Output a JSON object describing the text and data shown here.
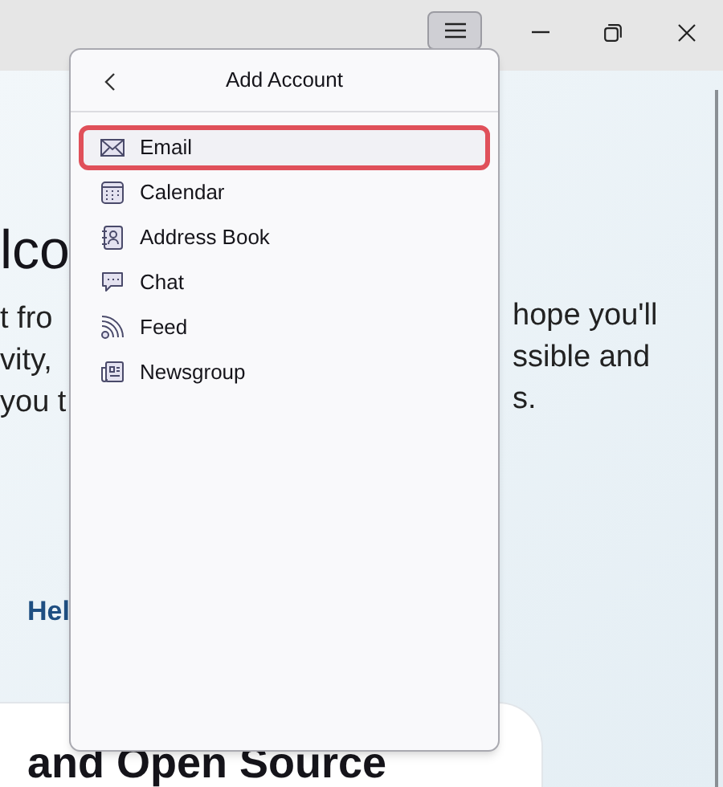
{
  "title_bar": {
    "menu_button": {
      "selected": true
    }
  },
  "background": {
    "left_fragments": [
      {
        "kind": "heading",
        "text": "lco"
      },
      {
        "kind": "line",
        "text": "t fro"
      },
      {
        "kind": "line",
        "text": "vity,"
      },
      {
        "kind": "line",
        "text": "you t"
      },
      {
        "kind": "link",
        "text": "Hel"
      }
    ],
    "right_fragments": [
      "hope you'll",
      "ssible and",
      "s."
    ],
    "card_heading": "and Open Source"
  },
  "menu": {
    "title": "Add Account",
    "items": [
      {
        "kind": "email",
        "label": "Email",
        "selected": true
      },
      {
        "kind": "calendar",
        "label": "Calendar",
        "selected": false
      },
      {
        "kind": "address-book",
        "label": "Address Book",
        "selected": false
      },
      {
        "kind": "chat",
        "label": "Chat",
        "selected": false
      },
      {
        "kind": "feed",
        "label": "Feed",
        "selected": false
      },
      {
        "kind": "newsgroup",
        "label": "Newsgroup",
        "selected": false
      }
    ]
  }
}
